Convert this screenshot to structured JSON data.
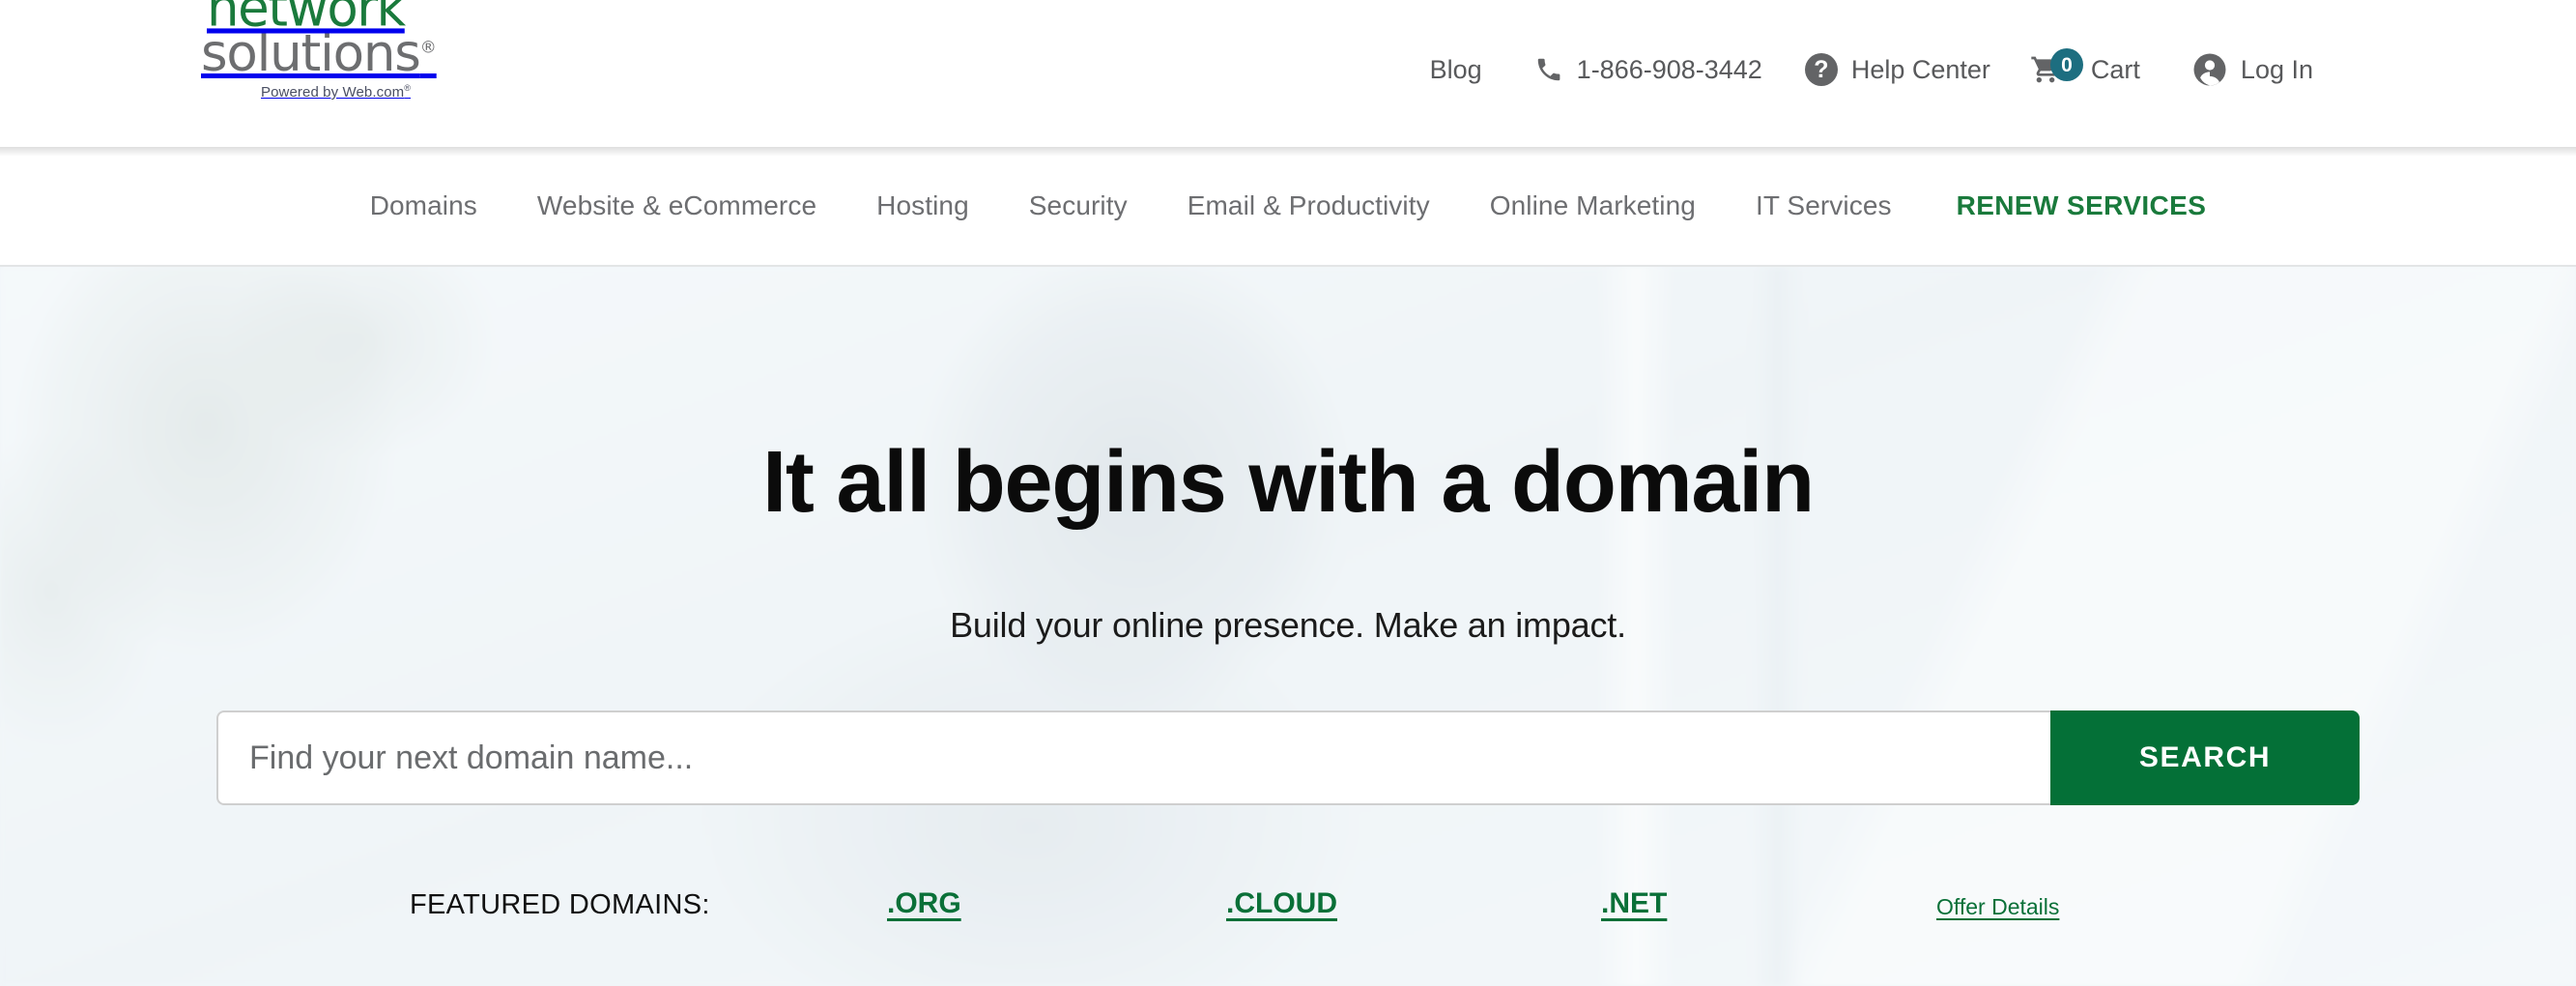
{
  "brand": {
    "logo_line1": "network",
    "logo_line2": "solutions",
    "logo_registered": "®",
    "logo_tagline": "Powered by Web.com",
    "logo_tagline_registered": "®",
    "green": "#1a7a3c",
    "gray": "#6d6e70",
    "accent_green": "#047037",
    "badge_teal": "#1d6e80"
  },
  "utility_nav": {
    "blog": "Blog",
    "phone": "1-866-908-3442",
    "help_center": "Help Center",
    "cart_label": "Cart",
    "cart_count": "0",
    "log_in": "Log In",
    "help_icon_glyph": "?"
  },
  "main_nav": {
    "items": [
      {
        "label": "Domains",
        "highlight": false
      },
      {
        "label": "Website & eCommerce",
        "highlight": false
      },
      {
        "label": "Hosting",
        "highlight": false
      },
      {
        "label": "Security",
        "highlight": false
      },
      {
        "label": "Email & Productivity",
        "highlight": false
      },
      {
        "label": "Online Marketing",
        "highlight": false
      },
      {
        "label": "IT Services",
        "highlight": false
      },
      {
        "label": "RENEW SERVICES",
        "highlight": true
      }
    ]
  },
  "hero": {
    "title": "It all begins with a domain",
    "subtitle": "Build your online presence. Make an impact.",
    "search": {
      "placeholder": "Find your next domain name...",
      "value": "",
      "button_label": "SEARCH"
    },
    "featured": {
      "label": "FEATURED DOMAINS:",
      "tlds": [
        ".ORG",
        ".CLOUD",
        ".NET"
      ],
      "offer_details": "Offer Details"
    }
  }
}
